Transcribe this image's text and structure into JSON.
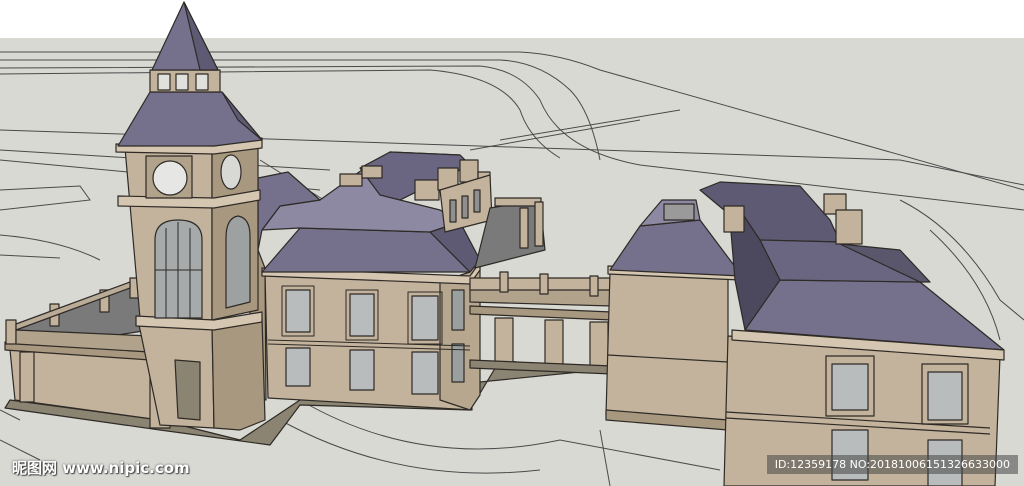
{
  "scene": {
    "description_id": "sketchup-model-view",
    "colors": {
      "sky": "#ffffff",
      "ground": "#d9d9d4",
      "wall": "#c3b39c",
      "wall_dark": "#a8987f",
      "roof": "#75708b",
      "roof_dark": "#5e5a73",
      "roof_light": "#8e89a3",
      "window": "#b9bcbc",
      "line": "#2e2a26"
    }
  },
  "watermark": {
    "site_text": "昵图网 www.nipic.com",
    "id_text": "ID:12359178 NO:20181006151326633000"
  }
}
